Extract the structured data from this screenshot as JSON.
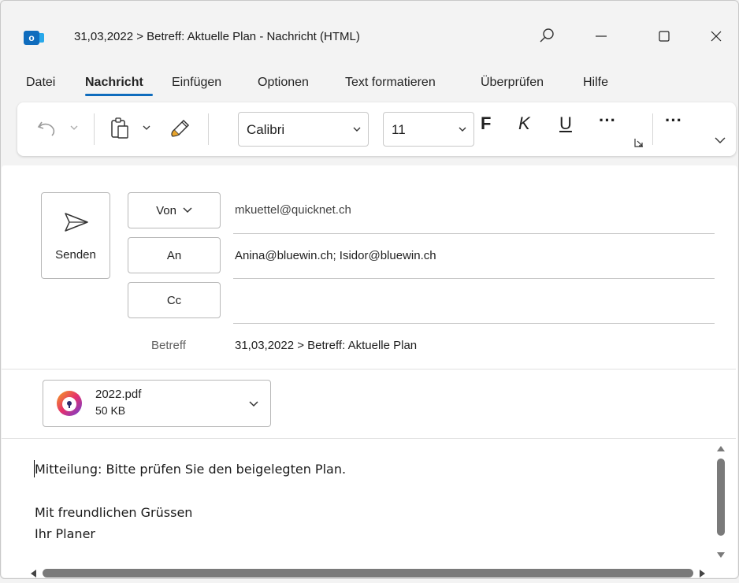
{
  "window": {
    "title": "31,03,2022 > Betreff: Aktuelle Plan  -  Nachricht (HTML)",
    "app_icon_letter": "o"
  },
  "menu": {
    "tabs": [
      "Datei",
      "Nachricht",
      "Einfügen",
      "Optionen",
      "Text formatieren",
      "Überprüfen",
      "Hilfe"
    ],
    "active": "Nachricht"
  },
  "ribbon": {
    "font": "Calibri",
    "size": "11",
    "bold": "F",
    "italic": "K",
    "underline": "U",
    "more": "···",
    "overflow": "···"
  },
  "compose": {
    "send_label": "Senden",
    "from_label": "Von",
    "from_value": "mkuettel@quicknet.ch",
    "to_label": "An",
    "to_value": "Anina@bluewin.ch; Isidor@bluewin.ch",
    "cc_label": "Cc",
    "cc_value": "",
    "subject_label": "Betreff",
    "subject_value": "31,03,2022 > Betreff: Aktuelle Plan"
  },
  "attachment": {
    "name": "2022.pdf",
    "size": "50 KB"
  },
  "body": {
    "lines": [
      "Mitteilung: Bitte prüfen Sie den beigelegten Plan.",
      "",
      "Mit freundlichen Grüssen",
      "Ihr Planer"
    ]
  },
  "colors": {
    "accent": "#0f6cbd",
    "background": "#f3f3f3"
  }
}
